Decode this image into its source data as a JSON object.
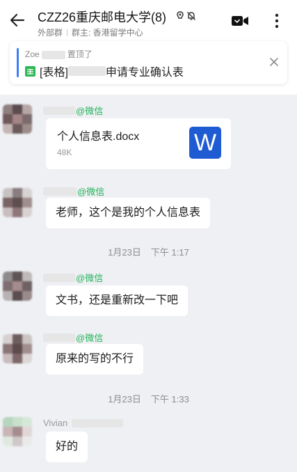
{
  "header": {
    "title": "CZZ26重庆邮电大学(8)",
    "subtitle_external": "外部群",
    "subtitle_owner": "群主: 香港留学中心"
  },
  "pinned": {
    "author": "Zoe",
    "action": "置顶了",
    "doc_prefix": "[表格]",
    "doc_suffix": "申请专业确认表"
  },
  "messages": [
    {
      "sender_tag": "@微信",
      "file_name": "个人信息表.docx",
      "file_size": "48K",
      "file_icon": "W"
    },
    {
      "sender_tag": "@微信",
      "text": "老师，这个是我的个人信息表"
    },
    {
      "sender_tag": "@微信",
      "text": "文书，还是重新改一下吧"
    },
    {
      "sender_tag": "@微信",
      "text": "原来的写的不行"
    },
    {
      "sender_name": "Vivian",
      "text": "好的"
    }
  ],
  "timestamps": [
    {
      "date": "1月23日",
      "time": "下午 1:17"
    },
    {
      "date": "1月23日",
      "time": "下午 1:33"
    }
  ],
  "colors": {
    "background": "#eff0f3",
    "wechat_green": "#21b45a",
    "word_blue": "#1f5bd3",
    "pin_bar": "#3a7ff6"
  },
  "icons": [
    "back-arrow-icon",
    "mute-icon",
    "bell-off-icon",
    "video-call-icon",
    "more-vertical-icon",
    "sheet-icon",
    "close-icon",
    "word-doc-icon"
  ]
}
